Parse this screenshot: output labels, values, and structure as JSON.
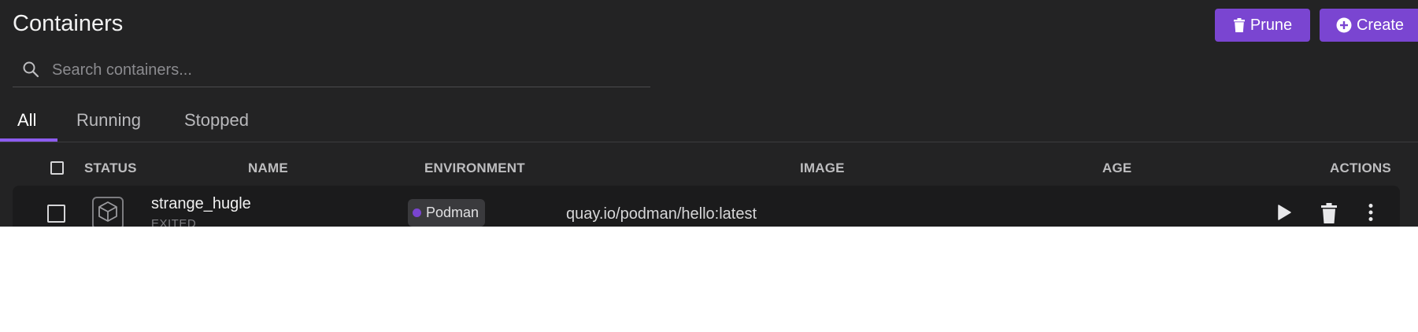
{
  "header": {
    "title": "Containers",
    "prune_label": "Prune",
    "create_label": "Create"
  },
  "search": {
    "placeholder": "Search containers...",
    "value": ""
  },
  "tabs": [
    {
      "label": "All",
      "active": true
    },
    {
      "label": "Running",
      "active": false
    },
    {
      "label": "Stopped",
      "active": false
    }
  ],
  "table": {
    "columns": [
      "STATUS",
      "NAME",
      "ENVIRONMENT",
      "IMAGE",
      "AGE",
      "ACTIONS"
    ],
    "rows": [
      {
        "name": "strange_hugle",
        "state": "EXITED",
        "environment": "Podman",
        "image": "quay.io/podman/hello:latest",
        "age": ""
      }
    ]
  },
  "colors": {
    "accent": "#7a45d1",
    "tab_indicator": "#8d5cf0",
    "background": "#232324",
    "row_background": "#1b1b1c"
  },
  "icons": {
    "prune": "trash-icon",
    "create": "plus-circle-icon",
    "search": "search-icon",
    "status": "container-cube-icon",
    "start": "play-icon",
    "delete": "trash-icon",
    "more": "kebab-menu-icon"
  }
}
